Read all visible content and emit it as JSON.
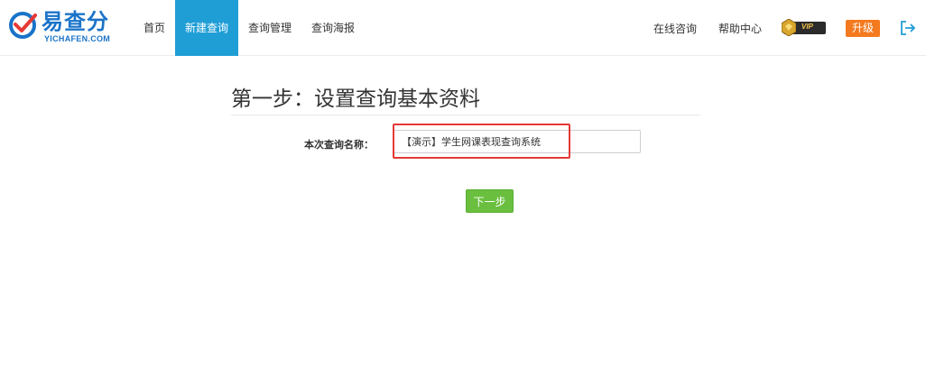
{
  "brand": {
    "name": "易查分",
    "sub": "YICHAFEN.COM",
    "color": "#1a73c9"
  },
  "nav": {
    "items": [
      {
        "label": "首页",
        "active": false
      },
      {
        "label": "新建查询",
        "active": true
      },
      {
        "label": "查询管理",
        "active": false
      },
      {
        "label": "查询海报",
        "active": false
      }
    ],
    "active_color": "#1f9ed6"
  },
  "right_nav": {
    "online_consult": "在线咨询",
    "help_center": "帮助中心",
    "vip_label": "VIP",
    "upgrade_label": "升级",
    "upgrade_color": "#f47a1f",
    "logout_icon": "logout-icon"
  },
  "main": {
    "step_title": "第一步：设置查询基本资料",
    "name_label": "本次查询名称：",
    "name_value": "【演示】学生网课表现查询系统",
    "highlight_color": "#e53935",
    "next_label": "下一步",
    "next_color": "#6abf3f"
  }
}
